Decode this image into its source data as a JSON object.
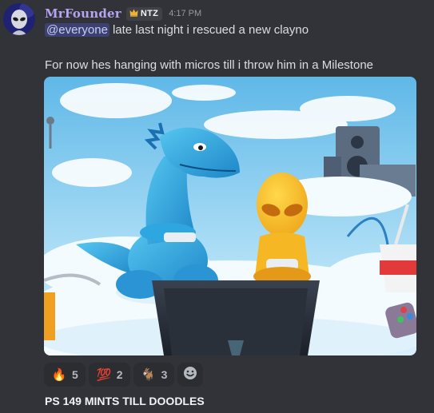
{
  "message": {
    "author": "MrFounder",
    "role_tag": {
      "icon": "crown-icon",
      "label": "NTZ"
    },
    "timestamp": "4:17 PM",
    "mention": "@everyone",
    "line1_text": "late last night i rescued a new clayno",
    "line2_text": "For now hes hanging with micros till i throw him in a Milestone"
  },
  "reactions": [
    {
      "emoji": "🔥",
      "icon": "fire-emoji-icon",
      "count": "5"
    },
    {
      "emoji": "💯",
      "icon": "hundred-points-emoji-icon",
      "count": "2"
    },
    {
      "emoji": "🐐",
      "icon": "goat-emoji-icon",
      "count": "3"
    }
  ],
  "add_reaction_icon": "smiley-add-reaction-icon",
  "next_message_text": "PS 149 MINTS TILL DOODLES",
  "colors": {
    "background": "#313338",
    "username": "#b7a3f0",
    "mention_bg": "#3c4270",
    "mention_text": "#c9cdfb",
    "reaction_bg": "#2b2d31"
  }
}
